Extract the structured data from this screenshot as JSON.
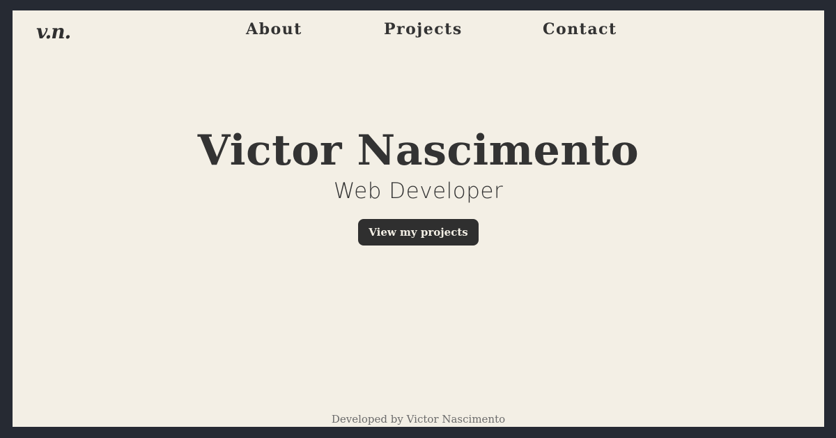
{
  "logo": {
    "text": "v.n."
  },
  "nav": {
    "items": [
      {
        "label": "About"
      },
      {
        "label": "Projects"
      },
      {
        "label": "Contact"
      }
    ]
  },
  "hero": {
    "name": "Victor Nascimento",
    "role": "Web Developer",
    "cta_label": "View my projects"
  },
  "footer": {
    "text": "Developed by Victor Nascimento"
  },
  "colors": {
    "page_background": "#f3efe5",
    "frame_background": "#262a33",
    "text": "#333333",
    "button_background": "#2f2f2f",
    "button_text": "#f3efe5",
    "footer_text": "#6b6b6b"
  }
}
